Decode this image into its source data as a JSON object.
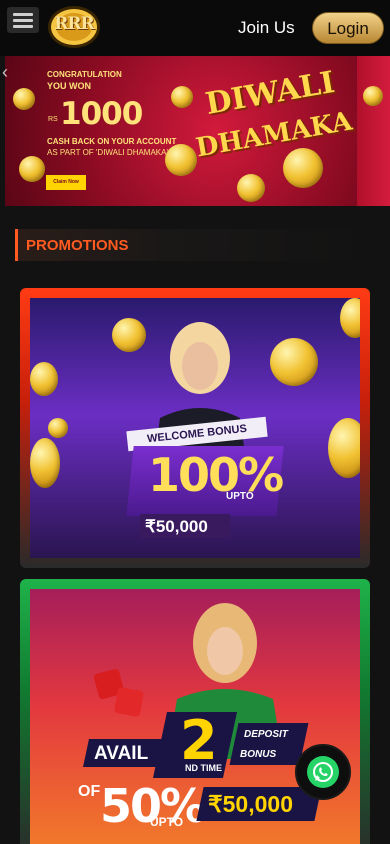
{
  "header": {
    "logo_text": "RRR",
    "join_label": "Join Us",
    "login_label": "Login"
  },
  "banner": {
    "line1": "CONGRATULATION",
    "line2": "YOU WON",
    "currency_prefix": "RS",
    "amount": "1000",
    "line3": "CASH BACK ON YOUR ACCOUNT",
    "line4": "AS PART OF 'DIWALI DHAMAKA'",
    "claim_label": "Claim Now",
    "title_top": "DIWALI",
    "title_bottom": "DHAMAKA",
    "prev_arrow": "‹",
    "slide_count": 4,
    "active_slide": 1
  },
  "section": {
    "title": "PROMOTIONS"
  },
  "promos": [
    {
      "tag": "WELCOME BONUS",
      "percent": "100%",
      "upto": "UPTO",
      "amount": "₹50,000",
      "frame_color": "#ff3b14"
    },
    {
      "avail": "AVAIL",
      "number": "2",
      "nd_time": "ND TIME",
      "deposit": "DEPOSIT",
      "bonus": "BONUS",
      "of": "OF",
      "percent": "50%",
      "upto": "UPTO",
      "amount": "₹50,000",
      "frame_color": "#1fb34a"
    }
  ],
  "icons": {
    "menu": "hamburger-icon",
    "whatsapp": "whatsapp-icon"
  },
  "colors": {
    "accent": "#ff5a1f",
    "login_gold": "#e0b65e",
    "whatsapp_green": "#25d366"
  }
}
